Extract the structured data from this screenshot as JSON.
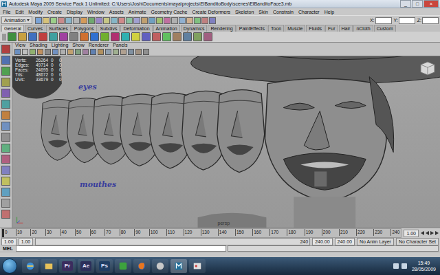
{
  "window": {
    "title": "Autodesk Maya 2009 Service Pack 1 Unlimited: C:\\Users\\Josh\\Documents\\maya\\projects\\ElBanditoBody\\scenes\\ElBanditoFace3.mb",
    "controls": [
      "_",
      "□",
      "×"
    ]
  },
  "menu": [
    "File",
    "Edit",
    "Modify",
    "Create",
    "Display",
    "Window",
    "Assets",
    "Animate",
    "Geometry Cache",
    "Create Deformers",
    "Skeleton",
    "Skin",
    "Constrain",
    "Character",
    "Help"
  ],
  "status_line": {
    "mode": "Animation",
    "fields": [
      "X:",
      "Y:",
      "Z:"
    ]
  },
  "shelf_tabs": [
    {
      "label": "General",
      "selected": true
    },
    {
      "label": "Curves",
      "selected": false
    },
    {
      "label": "Surfaces",
      "selected": false
    },
    {
      "label": "Polygons",
      "selected": false
    },
    {
      "label": "Subdivs",
      "selected": false
    },
    {
      "label": "Deformation",
      "selected": false
    },
    {
      "label": "Animation",
      "selected": false
    },
    {
      "label": "Dynamics",
      "selected": false
    },
    {
      "label": "Rendering",
      "selected": false
    },
    {
      "label": "PaintEffects",
      "selected": false
    },
    {
      "label": "Toon",
      "selected": false
    },
    {
      "label": "Muscle",
      "selected": false
    },
    {
      "label": "Fluids",
      "selected": false
    },
    {
      "label": "Fur",
      "selected": false
    },
    {
      "label": "Hair",
      "selected": false
    },
    {
      "label": "nCloth",
      "selected": false
    },
    {
      "label": "Custom",
      "selected": false
    }
  ],
  "viewport": {
    "menu": [
      "View",
      "Shading",
      "Lighting",
      "Show",
      "Renderer",
      "Panels"
    ],
    "hud": [
      {
        "label": "Verts:",
        "value": "26264",
        "a": "0",
        "b": "0"
      },
      {
        "label": "Edges:",
        "value": "49714",
        "a": "0",
        "b": "0"
      },
      {
        "label": "Faces:",
        "value": "24695",
        "a": "0",
        "b": "0"
      },
      {
        "label": "Tris:",
        "value": "48672",
        "a": "0",
        "b": "0"
      },
      {
        "label": "UVs:",
        "value": "33679",
        "a": "0",
        "b": "0"
      }
    ],
    "labels": {
      "eyes": "eyes",
      "mouths": "mouthes"
    },
    "camera": "persp"
  },
  "timeline": {
    "ticks": [
      "0",
      "10",
      "20",
      "30",
      "40",
      "50",
      "60",
      "70",
      "80",
      "90",
      "100",
      "110",
      "120",
      "130",
      "140",
      "150",
      "160",
      "170",
      "180",
      "190",
      "200",
      "210",
      "220",
      "230",
      "240"
    ],
    "level": 0.0,
    "current": "1.00"
  },
  "range": {
    "start": "1.00",
    "play_start": "1.00",
    "slider_end": "240",
    "play_end": "240.00",
    "end": "240.00",
    "anim_layer": "No Anim Layer",
    "character_set": "No Character Set"
  },
  "command_line": {
    "label": "MEL"
  },
  "taskbar": {
    "apps": [
      {
        "label": "Pr",
        "color": "#3b2d5e"
      },
      {
        "label": "Ae",
        "color": "#2c2f5a"
      },
      {
        "label": "Ps",
        "color": "#1f3d63"
      }
    ],
    "time": "15:49",
    "date": "28/05/2009"
  }
}
